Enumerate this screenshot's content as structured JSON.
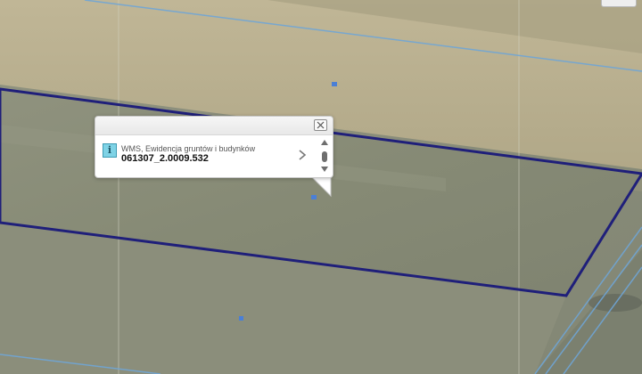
{
  "map": {
    "colors": {
      "parcel_boundary": "#1f1f7a",
      "cadastral_line": "#6fa5d6",
      "field_light": "#b6ab8c",
      "field_dark": "#8a8c78"
    },
    "markers": [
      "point-marker",
      "point-marker",
      "point-marker"
    ]
  },
  "popup": {
    "close_icon": "close-icon",
    "info_icon_glyph": "i",
    "layer_name": "WMS, Ewidencja gruntów i budynków",
    "parcel_id": "061307_2.0009.532",
    "next_icon": "chevron-right-icon",
    "scroll_up_icon": "triangle-up-icon",
    "scroll_down_icon": "triangle-down-icon"
  }
}
